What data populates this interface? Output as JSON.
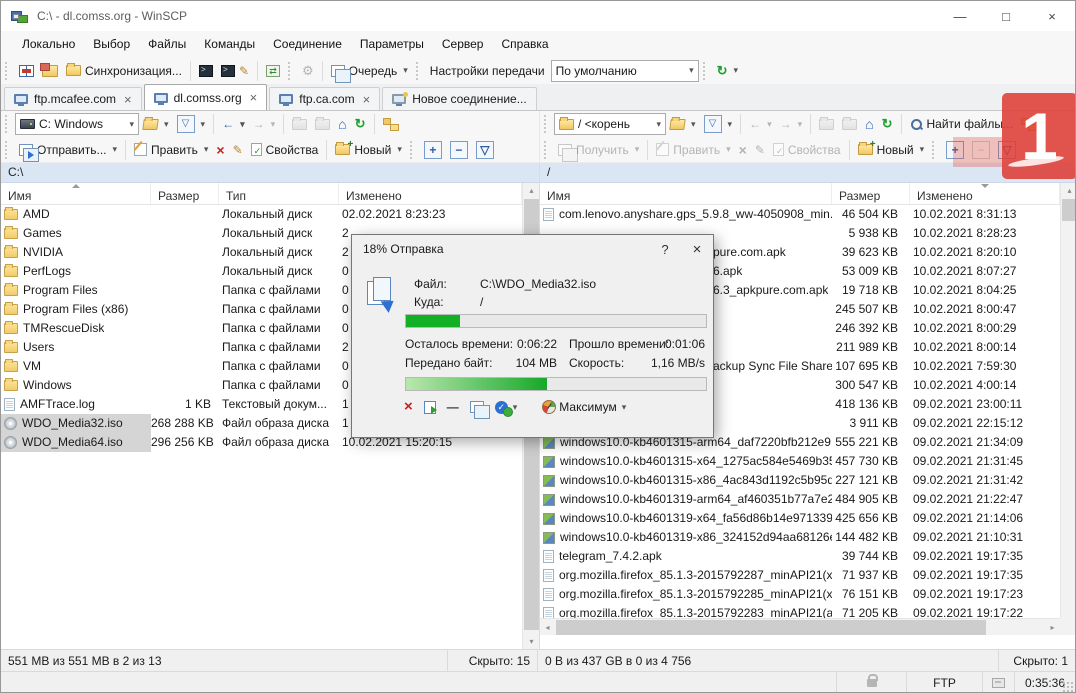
{
  "window": {
    "title": "C:\\ - dl.comss.org - WinSCP"
  },
  "glyphs": {
    "close": "×",
    "dropdown": "▾",
    "back": "←",
    "forward": "→",
    "home": "⌂",
    "refresh": "↻",
    "up": "▴",
    "down": "▾",
    "left": "◂",
    "right": "▸",
    "plus": "+",
    "minus": "−",
    "filter": "▽",
    "question": "?",
    "minimize": "—",
    "maximize": "□",
    "cross": "×",
    "check": "✓",
    "gear": "⚙",
    "pencil": "✎",
    "sync": "⇄",
    "updir": "↰"
  },
  "menu": {
    "items": [
      "Локально",
      "Выбор",
      "Файлы",
      "Команды",
      "Соединение",
      "Параметры",
      "Сервер",
      "Справка"
    ]
  },
  "toolbar": {
    "sync_label": "Синхронизация...",
    "queue_label": "Очередь",
    "transfer_settings_label": "Настройки передачи",
    "transfer_preset": "По умолчанию"
  },
  "tabs": {
    "items": [
      {
        "label": "ftp.mcafee.com",
        "active": false,
        "closable": true,
        "new": false
      },
      {
        "label": "dl.comss.org",
        "active": true,
        "closable": true,
        "new": false
      },
      {
        "label": "ftp.ca.com",
        "active": false,
        "closable": true,
        "new": false
      },
      {
        "label": "Новое соединение...",
        "active": false,
        "closable": false,
        "new": true
      }
    ]
  },
  "left_panel": {
    "drive_combo": "C: Windows",
    "path": "C:\\",
    "columns": [
      "Имя",
      "Размер",
      "Тип",
      "Изменено"
    ],
    "sort_column": "Имя",
    "sort_dir": "asc",
    "commands": {
      "send": "Отправить...",
      "edit": "Править",
      "props": "Свойства",
      "new_item": "Новый"
    },
    "rows": [
      {
        "name": "AMD",
        "icon": "folder",
        "size": "",
        "type": "Локальный диск",
        "modified": "02.02.2021  8:23:23",
        "selected": false
      },
      {
        "name": "Games",
        "icon": "folder",
        "size": "",
        "type": "Локальный диск",
        "modified": "2",
        "selected": false
      },
      {
        "name": "NVIDIA",
        "icon": "folder",
        "size": "",
        "type": "Локальный диск",
        "modified": "2",
        "selected": false
      },
      {
        "name": "PerfLogs",
        "icon": "folder",
        "size": "",
        "type": "Локальный диск",
        "modified": "0",
        "selected": false
      },
      {
        "name": "Program Files",
        "icon": "folder",
        "size": "",
        "type": "Папка с файлами",
        "modified": "0",
        "selected": false
      },
      {
        "name": "Program Files (x86)",
        "icon": "folder",
        "size": "",
        "type": "Папка с файлами",
        "modified": "0",
        "selected": false
      },
      {
        "name": "TMRescueDisk",
        "icon": "folder",
        "size": "",
        "type": "Папка с файлами",
        "modified": "0",
        "selected": false
      },
      {
        "name": "Users",
        "icon": "folder",
        "size": "",
        "type": "Папка с файлами",
        "modified": "2",
        "selected": false
      },
      {
        "name": "VM",
        "icon": "folder",
        "size": "",
        "type": "Папка с файлами",
        "modified": "0",
        "selected": false
      },
      {
        "name": "Windows",
        "icon": "folder",
        "size": "",
        "type": "Папка с файлами",
        "modified": "0",
        "selected": false
      },
      {
        "name": "AMFTrace.log",
        "icon": "doc",
        "size": "1 KB",
        "type": "Текстовый докум...",
        "modified": "1",
        "selected": false
      },
      {
        "name": "WDO_Media32.iso",
        "icon": "disc",
        "size": "268 288 KB",
        "type": "Файл образа диска",
        "modified": "1",
        "selected": true
      },
      {
        "name": "WDO_Media64.iso",
        "icon": "disc",
        "size": "296 256 KB",
        "type": "Файл образа диска",
        "modified": "10.02.2021  15:20:15",
        "selected": true
      }
    ],
    "status_size": "551 MB из 551 MB в 2 из 13",
    "status_hidden": "Скрыто: 15"
  },
  "right_panel": {
    "path_combo": "/ <корень",
    "path": "/",
    "find_label": "Найти файлы...",
    "columns": [
      "Имя",
      "Размер",
      "Изменено"
    ],
    "sort_column": "Изменено",
    "sort_dir": "desc",
    "commands": {
      "get": "Получить",
      "edit": "Править",
      "props": "Свойства",
      "new_item": "Новый"
    },
    "rows": [
      {
        "name": "com.lenovo.anyshare.gps_5.9.8_ww-4050908_min...",
        "icon": "doc",
        "occluded": false,
        "size": "46 504 KB",
        "modified": "10.02.2021 8:31:13"
      },
      {
        "name": "",
        "icon": "none",
        "occluded": true,
        "size": "5 938 KB",
        "modified": "10.02.2021 8:28:23"
      },
      {
        "name": "pure.com.apk",
        "icon": "none",
        "occluded": true,
        "size": "39 623 KB",
        "modified": "10.02.2021 8:20:10"
      },
      {
        "name": "6.apk",
        "icon": "none",
        "occluded": true,
        "size": "53 009 KB",
        "modified": "10.02.2021 8:07:27"
      },
      {
        "name": "6.3_apkpure.com.apk",
        "icon": "none",
        "occluded": true,
        "size": "19 718 KB",
        "modified": "10.02.2021 8:04:25"
      },
      {
        "name": "",
        "icon": "none",
        "occluded": true,
        "size": "245 507 KB",
        "modified": "10.02.2021 8:00:47"
      },
      {
        "name": "",
        "icon": "none",
        "occluded": true,
        "size": "246 392 KB",
        "modified": "10.02.2021 8:00:29"
      },
      {
        "name": "",
        "icon": "none",
        "occluded": true,
        "size": "211 989 KB",
        "modified": "10.02.2021 8:00:14"
      },
      {
        "name": "ackup Sync File Share...",
        "icon": "none",
        "occluded": true,
        "size": "107 695 KB",
        "modified": "10.02.2021 7:59:30"
      },
      {
        "name": "",
        "icon": "none",
        "occluded": true,
        "size": "300 547 KB",
        "modified": "10.02.2021 4:00:14"
      },
      {
        "name": "",
        "icon": "none",
        "occluded": true,
        "size": "418 136 KB",
        "modified": "09.02.2021 23:00:11"
      },
      {
        "name": "",
        "icon": "none",
        "occluded": true,
        "size": "3 911 KB",
        "modified": "09.02.2021 22:15:12"
      },
      {
        "name": "windows10.0-kb4601315-arm64_daf7220bfb212e9...",
        "icon": "win",
        "occluded": false,
        "size": "555 221 KB",
        "modified": "09.02.2021 21:34:09"
      },
      {
        "name": "windows10.0-kb4601315-x64_1275ac584e5469b35...",
        "icon": "win",
        "occluded": false,
        "size": "457 730 KB",
        "modified": "09.02.2021 21:31:45"
      },
      {
        "name": "windows10.0-kb4601315-x86_4ac843d1192c5b95d...",
        "icon": "win",
        "occluded": false,
        "size": "227 121 KB",
        "modified": "09.02.2021 21:31:42"
      },
      {
        "name": "windows10.0-kb4601319-arm64_af460351b77a7e2...",
        "icon": "win",
        "occluded": false,
        "size": "484 905 KB",
        "modified": "09.02.2021 21:22:47"
      },
      {
        "name": "windows10.0-kb4601319-x64_fa56d86b14e971339...",
        "icon": "win",
        "occluded": false,
        "size": "425 656 KB",
        "modified": "09.02.2021 21:14:06"
      },
      {
        "name": "windows10.0-kb4601319-x86_324152d94aa68126e...",
        "icon": "win",
        "occluded": false,
        "size": "144 482 KB",
        "modified": "09.02.2021 21:10:31"
      },
      {
        "name": "telegram_7.4.2.apk",
        "icon": "doc",
        "occluded": false,
        "size": "39 744 KB",
        "modified": "09.02.2021 19:17:35"
      },
      {
        "name": "org.mozilla.firefox_85.1.3-2015792287_minAPI21(x...",
        "icon": "doc",
        "occluded": false,
        "size": "71 937 KB",
        "modified": "09.02.2021 19:17:35"
      },
      {
        "name": "org.mozilla.firefox_85.1.3-2015792285_minAPI21(x...",
        "icon": "doc",
        "occluded": false,
        "size": "76 151 KB",
        "modified": "09.02.2021 19:17:23"
      },
      {
        "name": "org.mozilla.firefox_85.1.3-2015792283_minAPI21(a...",
        "icon": "doc",
        "occluded": false,
        "size": "71 205 KB",
        "modified": "09.02.2021 19:17:22"
      }
    ],
    "status_size": "0 B из 437 GB в 0 из 4 756",
    "status_hidden": "Скрыто: 1"
  },
  "dialog": {
    "title": "18% Отправка",
    "file_label": "Файл:",
    "file_value": "C:\\WDO_Media32.iso",
    "target_label": "Куда:",
    "target_value": "/",
    "progress_percent": 18,
    "time_left_label": "Осталось времени:",
    "time_left": "0:06:22",
    "time_elapsed_label": "Прошло времени:",
    "time_elapsed": "0:01:06",
    "bytes_label": "Передано байт:",
    "bytes": "104 MB",
    "speed_label": "Скорость:",
    "speed": "1,16 MB/s",
    "speed_progress_percent": 47,
    "speed_limit_label": "Максимум"
  },
  "statusbar": {
    "protocol": "FTP",
    "session_time": "0:35:36"
  },
  "watermark": {
    "text": "1"
  },
  "colors": {
    "accent": "#2b6cd4",
    "progress_green": "#12b025",
    "selection_gray": "#d5d5d5",
    "watermark_red": "#de3e36",
    "pathbar_blue": "#dbe6f4"
  }
}
